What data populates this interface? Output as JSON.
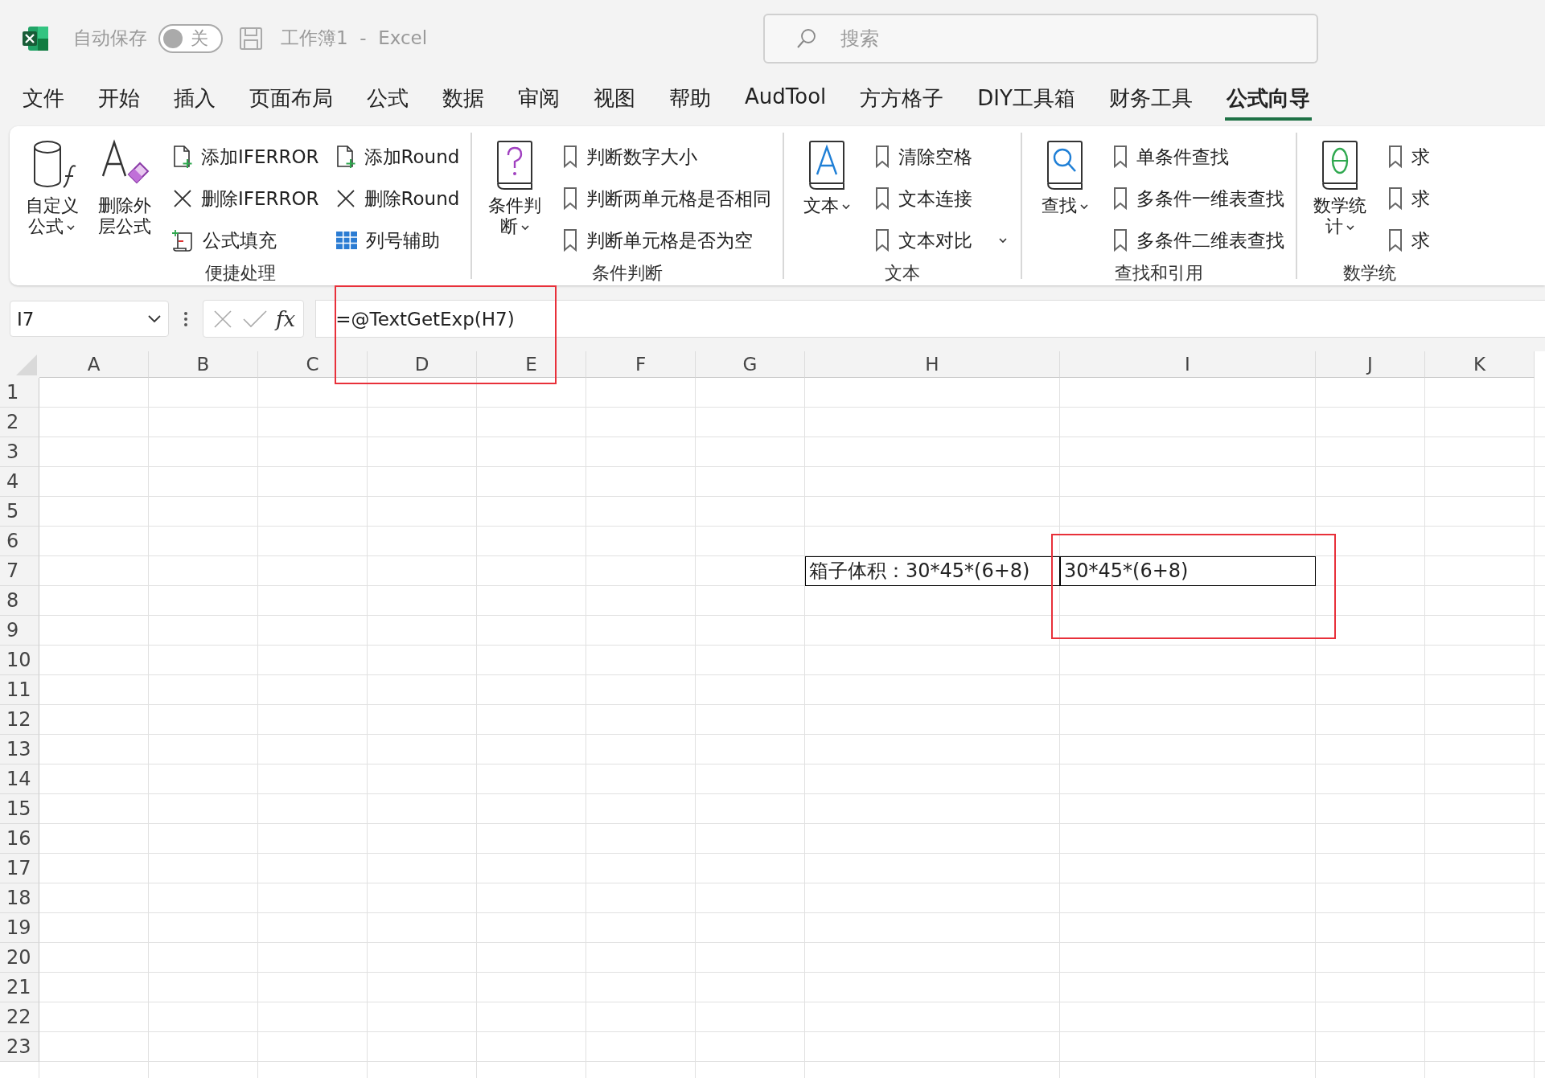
{
  "title_bar": {
    "autosave": {
      "label": "自动保存",
      "on": false,
      "state_text": "关"
    },
    "document_title": "工作簿1  -  Excel",
    "search": {
      "placeholder": "搜索"
    }
  },
  "tabs": [
    {
      "label": "文件",
      "selected": false
    },
    {
      "label": "开始",
      "selected": false
    },
    {
      "label": "插入",
      "selected": false
    },
    {
      "label": "页面布局",
      "selected": false
    },
    {
      "label": "公式",
      "selected": false
    },
    {
      "label": "数据",
      "selected": false
    },
    {
      "label": "审阅",
      "selected": false
    },
    {
      "label": "视图",
      "selected": false
    },
    {
      "label": "帮助",
      "selected": false
    },
    {
      "label": "AudTool",
      "selected": false
    },
    {
      "label": "方方格子",
      "selected": false
    },
    {
      "label": "DIY工具箱",
      "selected": false
    },
    {
      "label": "财务工具",
      "selected": false
    },
    {
      "label": "公式向导",
      "selected": true
    }
  ],
  "ribbon": {
    "groups": [
      {
        "label": "便捷处理",
        "large_buttons": [
          {
            "label": "自定义公式",
            "kind": "custom",
            "has_menu": true
          },
          {
            "label": "删除外层公式",
            "kind": "strip",
            "has_menu": false
          }
        ],
        "columns": [
          [
            {
              "label": "添加IFERROR",
              "kind": "add",
              "has_menu": false
            },
            {
              "label": "删除IFERROR",
              "kind": "remove",
              "has_menu": false
            },
            {
              "label": "公式填充",
              "kind": "fill",
              "has_menu": false
            }
          ],
          [
            {
              "label": "添加Round",
              "kind": "add",
              "has_menu": false
            },
            {
              "label": "删除Round",
              "kind": "remove",
              "has_menu": false
            },
            {
              "label": "列号辅助",
              "kind": "grid",
              "has_menu": false
            }
          ]
        ]
      },
      {
        "label": "条件判断",
        "large_buttons": [
          {
            "label": "条件判断",
            "kind": "condition",
            "has_menu": true
          }
        ],
        "columns": [
          [
            {
              "label": "判断数字大小",
              "kind": "bookmark",
              "has_menu": false
            },
            {
              "label": "判断两单元格是否相同",
              "kind": "bookmark",
              "has_menu": false
            },
            {
              "label": "判断单元格是否为空",
              "kind": "bookmark",
              "has_menu": false
            }
          ]
        ]
      },
      {
        "label": "文本",
        "large_buttons": [
          {
            "label": "文本",
            "kind": "text",
            "has_menu": true
          }
        ],
        "columns": [
          [
            {
              "label": "清除空格",
              "kind": "bookmark",
              "has_menu": false
            },
            {
              "label": "文本连接",
              "kind": "bookmark",
              "has_menu": false
            },
            {
              "label": "文本对比",
              "kind": "bookmark",
              "has_menu": true
            }
          ]
        ]
      },
      {
        "label": "查找和引用",
        "large_buttons": [
          {
            "label": "查找",
            "kind": "lookup",
            "has_menu": true
          }
        ],
        "columns": [
          [
            {
              "label": "单条件查找",
              "kind": "bookmark",
              "has_menu": false
            },
            {
              "label": "多条件一维表查找",
              "kind": "bookmark",
              "has_menu": false
            },
            {
              "label": "多条件二维表查找",
              "kind": "bookmark",
              "has_menu": false
            }
          ]
        ]
      },
      {
        "label": "数学统",
        "large_buttons": [
          {
            "label": "数学统计",
            "kind": "math",
            "has_menu": true
          }
        ],
        "columns": [
          [
            {
              "label": "求",
              "kind": "bookmark",
              "has_menu": false
            },
            {
              "label": "求",
              "kind": "bookmark",
              "has_menu": false
            },
            {
              "label": "求",
              "kind": "bookmark",
              "has_menu": false
            }
          ]
        ]
      }
    ]
  },
  "formula_bar": {
    "name_box": "I7",
    "function_label": "fx",
    "formula": "=@TextGetExp(H7)"
  },
  "sheet": {
    "columns": [
      "A",
      "B",
      "C",
      "D",
      "E",
      "F",
      "G",
      "H",
      "I",
      "J",
      "K"
    ],
    "rows": [
      {
        "label": "1"
      },
      {
        "label": "2"
      },
      {
        "label": "3"
      },
      {
        "label": "4"
      },
      {
        "label": "5"
      },
      {
        "label": "6"
      },
      {
        "label": "7",
        "cells": [
          null,
          null,
          null,
          null,
          null,
          null,
          null,
          {
            "text": "箱子体积：30*45*(6+8)",
            "boxed": true
          },
          {
            "text": "30*45*(6+8)",
            "boxed": true
          },
          null,
          null
        ]
      },
      {
        "label": "8"
      },
      {
        "label": "9"
      },
      {
        "label": "10"
      },
      {
        "label": "11"
      },
      {
        "label": "12"
      },
      {
        "label": "13"
      },
      {
        "label": "14"
      },
      {
        "label": "15"
      },
      {
        "label": "16"
      },
      {
        "label": "17"
      },
      {
        "label": "18"
      },
      {
        "label": "19"
      },
      {
        "label": "20"
      },
      {
        "label": "21"
      },
      {
        "label": "22"
      },
      {
        "label": "23"
      }
    ]
  }
}
